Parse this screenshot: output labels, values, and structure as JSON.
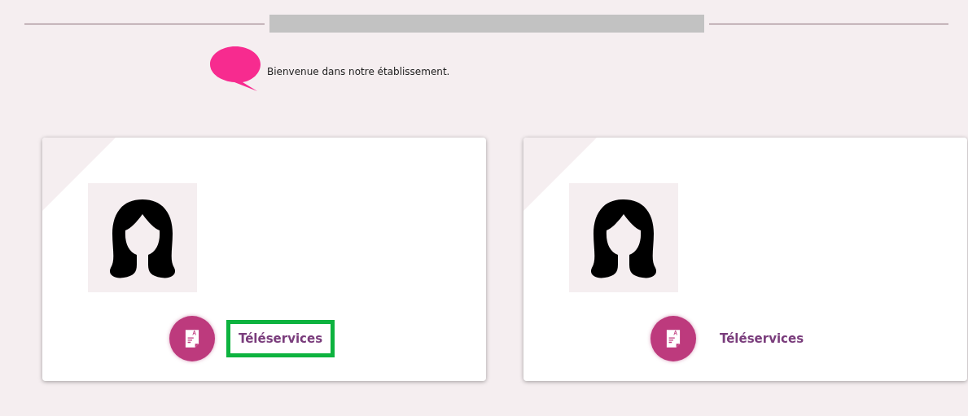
{
  "welcome": {
    "message": "Bienvenue dans notre établissement."
  },
  "cards": [
    {
      "link": {
        "label": "Téléservices",
        "highlighted": true
      }
    },
    {
      "link": {
        "label": "Téléservices",
        "highlighted": false
      }
    }
  ]
}
